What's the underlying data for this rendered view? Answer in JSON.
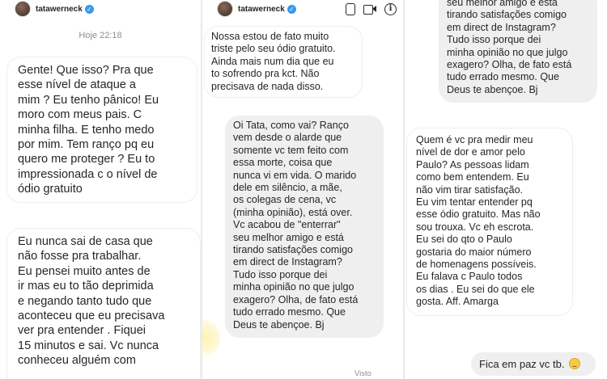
{
  "panel1": {
    "username": "tatawerneck",
    "timestamp": "Hoje 22:18",
    "messages": [
      "Gente! Que isso? Pra que\nesse nível de ataque a\nmim ? Eu tenho pânico! Eu\nmoro com meus pais. C\nminha filha. E tenho medo\npor mim. Tem ranço pq eu\nquero me proteger ? Eu to\nimpressionada c o nível de\nódio gratuito",
      "Eu nunca sai de casa que\nnão fosse pra trabalhar.\nEu pensei muito antes de\nir mas eu to tão deprimida\ne negando tanto tudo que\naconteceu que eu precisava\nver pra entender . Fiquei\n15 minutos e sai. Vc nunca\nconheceu alguém com"
    ]
  },
  "panel2": {
    "username": "tatawerneck",
    "messages": [
      "Nossa estou de fato muito\ntriste pelo seu ódio gratuito.\nAinda mais num dia que eu\nto sofrendo pra kct. Não\nprecisava de nada disso.",
      "Oi Tata, como vai? Ranço\nvem desde o alarde que\nsomente vc tem feito com\nessa morte, coisa que\nnunca vi em vida. O marido\ndele em silêncio, a mãe,\nos colegas de cena, vc\n(minha opinião), está over.\nVc acabou de \"enterrar\"\nseu melhor amigo e está\ntirando satisfações comigo\nem direct de Instagram?\nTudo  isso porque dei\nminha opinião no que julgo\nexagero? Olha, de fato está\ntudo errado mesmo. Que\nDeus te abençoe. Bj"
    ],
    "seen": "Visto"
  },
  "panel3": {
    "messages": [
      "seu melhor amigo e está\ntirando satisfações comigo\nem direct de Instagram?\nTudo  isso porque dei\nminha opinião no que julgo\nexagero? Olha, de fato está\ntudo errado mesmo. Que\nDeus te abençoe. Bj",
      "Quem é vc pra medir meu\nnível de dor e amor pelo\nPaulo? As pessoas lidam\ncomo bem entendem. Eu\nnão vim tirar satisfação.\nEu vim tentar entender pq\nesse ódio gratuito. Mas não\nsou trouxa. Vc eh escrota.\nEu sei do qto o Paulo\ngostaria do maior número\nde homenagens possíveis.\nEu falava c Paulo todos\nos dias . Eu sei do que ele\ngosta. Aff. Amarga",
      "Fica em paz vc tb."
    ]
  }
}
